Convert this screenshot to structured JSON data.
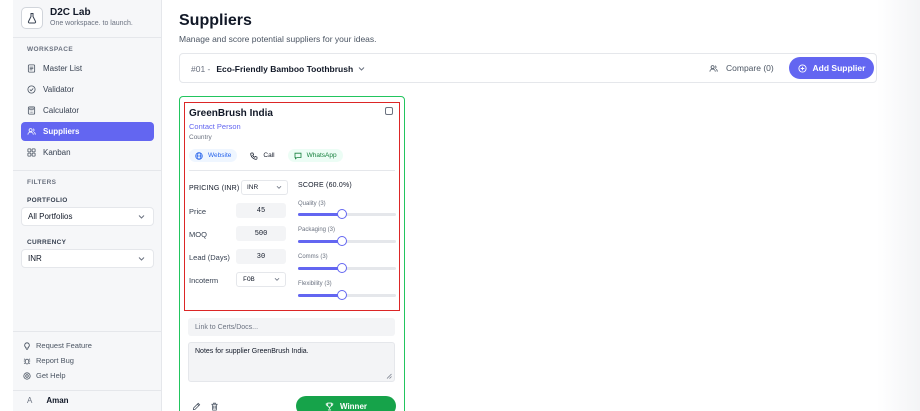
{
  "app": {
    "name": "D2C Lab",
    "tagline": "One workspace. to launch."
  },
  "sidebar": {
    "workspace_label": "WORKSPACE",
    "items": [
      {
        "label": "Master List",
        "icon": "list-icon",
        "active": false
      },
      {
        "label": "Validator",
        "icon": "check-circle-icon",
        "active": false
      },
      {
        "label": "Calculator",
        "icon": "calculator-icon",
        "active": false
      },
      {
        "label": "Suppliers",
        "icon": "users-icon",
        "active": true
      },
      {
        "label": "Kanban",
        "icon": "kanban-icon",
        "active": false
      }
    ],
    "filters_label": "FILTERS",
    "portfolio_label": "PORTFOLIO",
    "portfolio_value": "All Portfolios",
    "currency_label": "CURRENCY",
    "currency_value": "INR",
    "footer": [
      {
        "label": "Request Feature",
        "icon": "lightbulb-icon"
      },
      {
        "label": "Report Bug",
        "icon": "bug-icon"
      },
      {
        "label": "Get Help",
        "icon": "help-icon"
      }
    ],
    "user": {
      "initial": "A",
      "name": "Aman"
    }
  },
  "page": {
    "title": "Suppliers",
    "subtitle": "Manage and score potential suppliers for your ideas."
  },
  "toolbar": {
    "idea_number": "#01 -",
    "idea_name": "Eco-Friendly Bamboo Toothbrush",
    "compare_label": "Compare (0)",
    "add_label": "Add Supplier"
  },
  "card": {
    "name": "GreenBrush India",
    "contact": "Contact Person",
    "country": "Country",
    "links": {
      "website": "Website",
      "call": "Call",
      "whatsapp": "WhatsApp"
    },
    "pricing_label": "PRICING (INR)",
    "pricing_currency": "INR",
    "fields": {
      "price_label": "Price",
      "price": "45",
      "moq_label": "MOQ",
      "moq": "500",
      "lead_label": "Lead (Days)",
      "lead": "30",
      "incoterm_label": "Incoterm",
      "incoterm": "FOB"
    },
    "score_label": "SCORE (60.0%)",
    "sliders": [
      {
        "label": "Quality (3)",
        "value": 3,
        "max": 5
      },
      {
        "label": "Packaging (3)",
        "value": 3,
        "max": 5
      },
      {
        "label": "Comms (3)",
        "value": 3,
        "max": 5
      },
      {
        "label": "Flexibility (3)",
        "value": 3,
        "max": 5
      }
    ],
    "certs_placeholder": "Link to Certs/Docs...",
    "notes": "Notes for supplier GreenBrush India.",
    "winner_label": "Winner"
  },
  "colors": {
    "accent": "#6366f1",
    "winner": "#16a34a",
    "selected_border": "#22c55e",
    "highlight_border": "#dc2626"
  }
}
